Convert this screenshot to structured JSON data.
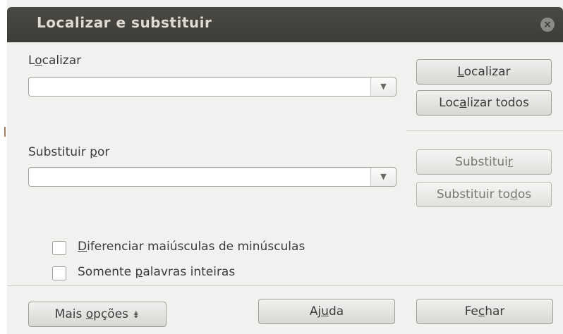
{
  "dialog": {
    "title": "Localizar e substituir",
    "close_icon": "close-icon"
  },
  "find": {
    "label_prefix": "L",
    "label_mnemonic": "o",
    "label_rest": "calizar",
    "value": "",
    "find_button": {
      "mnemonic": "L",
      "rest": "ocalizar"
    },
    "find_all_button": {
      "before": "Loc",
      "mnemonic": "a",
      "after": "lizar todos"
    }
  },
  "replace": {
    "label_before": "Substituir ",
    "label_mnemonic": "p",
    "label_after": "or",
    "value": "",
    "replace_button": {
      "before": "Substitui",
      "mnemonic": "r",
      "after": ""
    },
    "replace_all_button": {
      "before": "Substituir to",
      "mnemonic": "d",
      "after": "os"
    }
  },
  "options": {
    "match_case": {
      "mnemonic": "D",
      "rest": "iferenciar maiúsculas de minúsculas",
      "checked": false
    },
    "whole_words": {
      "before": "Somente ",
      "mnemonic": "p",
      "after": "alavras inteiras",
      "checked": false
    }
  },
  "footer": {
    "more_options": {
      "before": "Mais ",
      "mnemonic": "o",
      "after": "pções",
      "icon": "double-chevron-down-icon"
    },
    "help": {
      "before": "Aj",
      "mnemonic": "u",
      "after": "da"
    },
    "close": {
      "before": "Fe",
      "mnemonic": "c",
      "after": "har"
    }
  }
}
